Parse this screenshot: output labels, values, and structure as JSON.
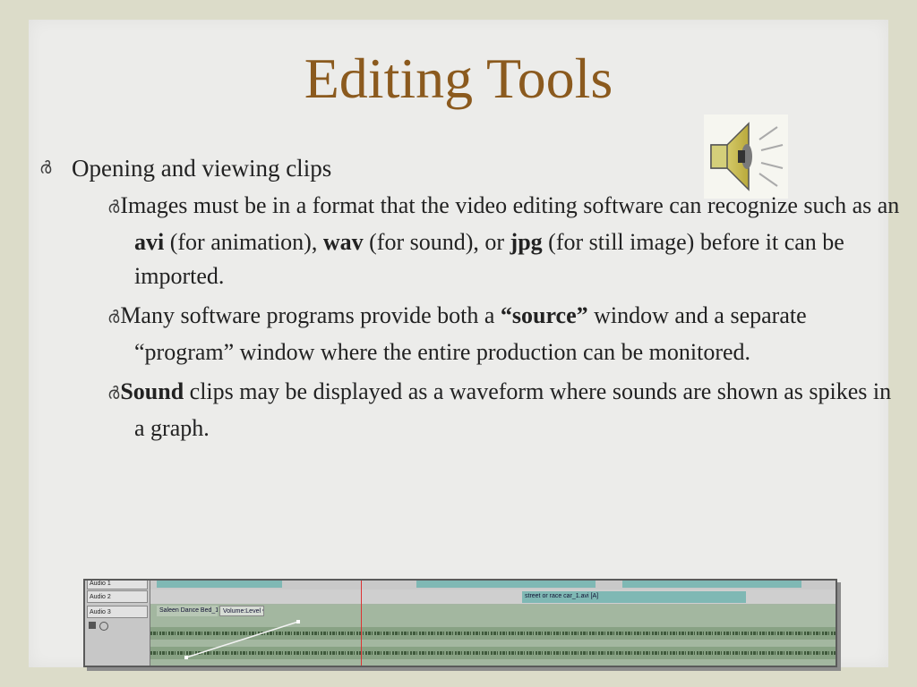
{
  "title": "Editing Tools",
  "bullet_glyph": "ർ",
  "bullets": {
    "b1": "Opening and viewing clips",
    "s1": {
      "p1": "Images must be in a format that the video editing software can recognize such as an ",
      "avi": "avi",
      "p2": " (for animation), ",
      "wav": "wav",
      "p3": " (for sound), or ",
      "jpg": "jpg",
      "p4": " (for still image) before it can be imported."
    },
    "s2": {
      "p1": "Many software programs provide both a ",
      "source": "“source”",
      "p2": " window and a separate “program” window where the entire production can be monitored."
    },
    "s3": {
      "sound": "Sound",
      "p1": " clips may be displayed as a waveform where sounds are shown as spikes in a graph."
    }
  },
  "timeline": {
    "labels": {
      "audio1": "Audio 1",
      "audio2": "Audio 2",
      "audio3": "Audio 3"
    },
    "clips": {
      "street": "street or race car_1.avi [A]",
      "dance": "Saleen Dance Bed_1.avi",
      "volume": "Volume:Level ▾"
    }
  },
  "icons": {
    "speaker": "speaker-icon"
  },
  "colors": {
    "title": "#8b5a1e",
    "background": "#ececea",
    "frame": "#dcdcc9"
  }
}
